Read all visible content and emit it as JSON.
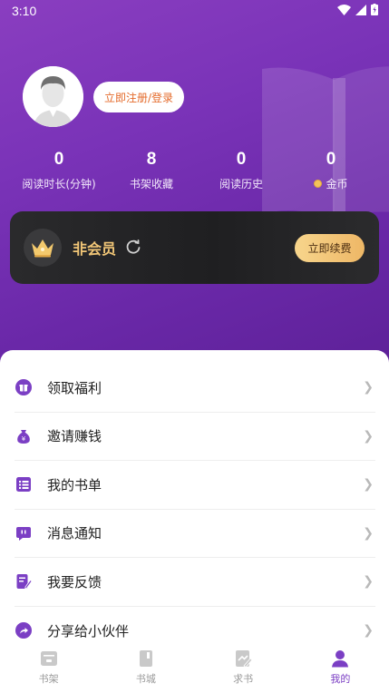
{
  "status_bar": {
    "time": "3:10"
  },
  "profile": {
    "login_label": "立即注册/登录"
  },
  "stats": [
    {
      "value": "0",
      "label": "阅读时长(分钟)"
    },
    {
      "value": "8",
      "label": "书架收藏"
    },
    {
      "value": "0",
      "label": "阅读历史"
    },
    {
      "value": "0",
      "label": "金币"
    }
  ],
  "vip": {
    "label": "非会员",
    "renew_label": "立即续费"
  },
  "menu": [
    {
      "label": "领取福利",
      "icon": "gift-icon"
    },
    {
      "label": "邀请赚钱",
      "icon": "money-bag-icon"
    },
    {
      "label": "我的书单",
      "icon": "list-icon"
    },
    {
      "label": "消息通知",
      "icon": "message-icon"
    },
    {
      "label": "我要反馈",
      "icon": "feedback-icon"
    },
    {
      "label": "分享给小伙伴",
      "icon": "share-icon"
    }
  ],
  "tabs": [
    {
      "label": "书架",
      "active": false
    },
    {
      "label": "书城",
      "active": false
    },
    {
      "label": "求书",
      "active": false
    },
    {
      "label": "我的",
      "active": true
    }
  ],
  "colors": {
    "accent": "#7b3fc4",
    "hero": "#7a33b8",
    "vip_gold": "#f1c677"
  }
}
